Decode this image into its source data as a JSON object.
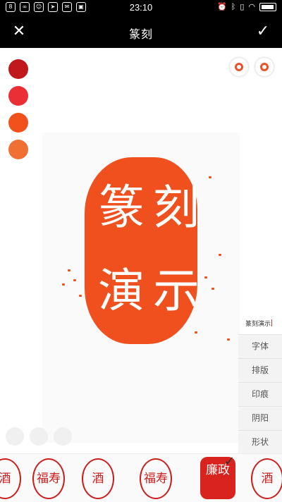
{
  "status_bar": {
    "time": "23:10",
    "icons_left": [
      "notification-icon",
      "link-icon",
      "android-icon",
      "navigation-icon",
      "mail-icon",
      "photo-icon"
    ],
    "icons_right": [
      "alarm-icon",
      "bluetooth-icon",
      "vibrate-icon",
      "wifi-icon",
      "battery-icon"
    ]
  },
  "header": {
    "title": "篆刻",
    "close_icon": "close-icon",
    "confirm_icon": "check-icon"
  },
  "colors": {
    "swatches": [
      "#c0181d",
      "#ea2f36",
      "#f2511b",
      "#f07033"
    ],
    "seal_color": "#f0501e"
  },
  "seal": {
    "text": "篆刻演示",
    "chars": [
      "刻",
      "篆",
      "示",
      "演"
    ]
  },
  "side_menu": {
    "items": [
      "字体",
      "排版",
      "印痕",
      "阴阳",
      "形状"
    ]
  },
  "thumbnails": {
    "items": [
      "酒",
      "福寿",
      "酒",
      "福寿",
      "廉政",
      "酒"
    ],
    "selected_index": 4
  }
}
